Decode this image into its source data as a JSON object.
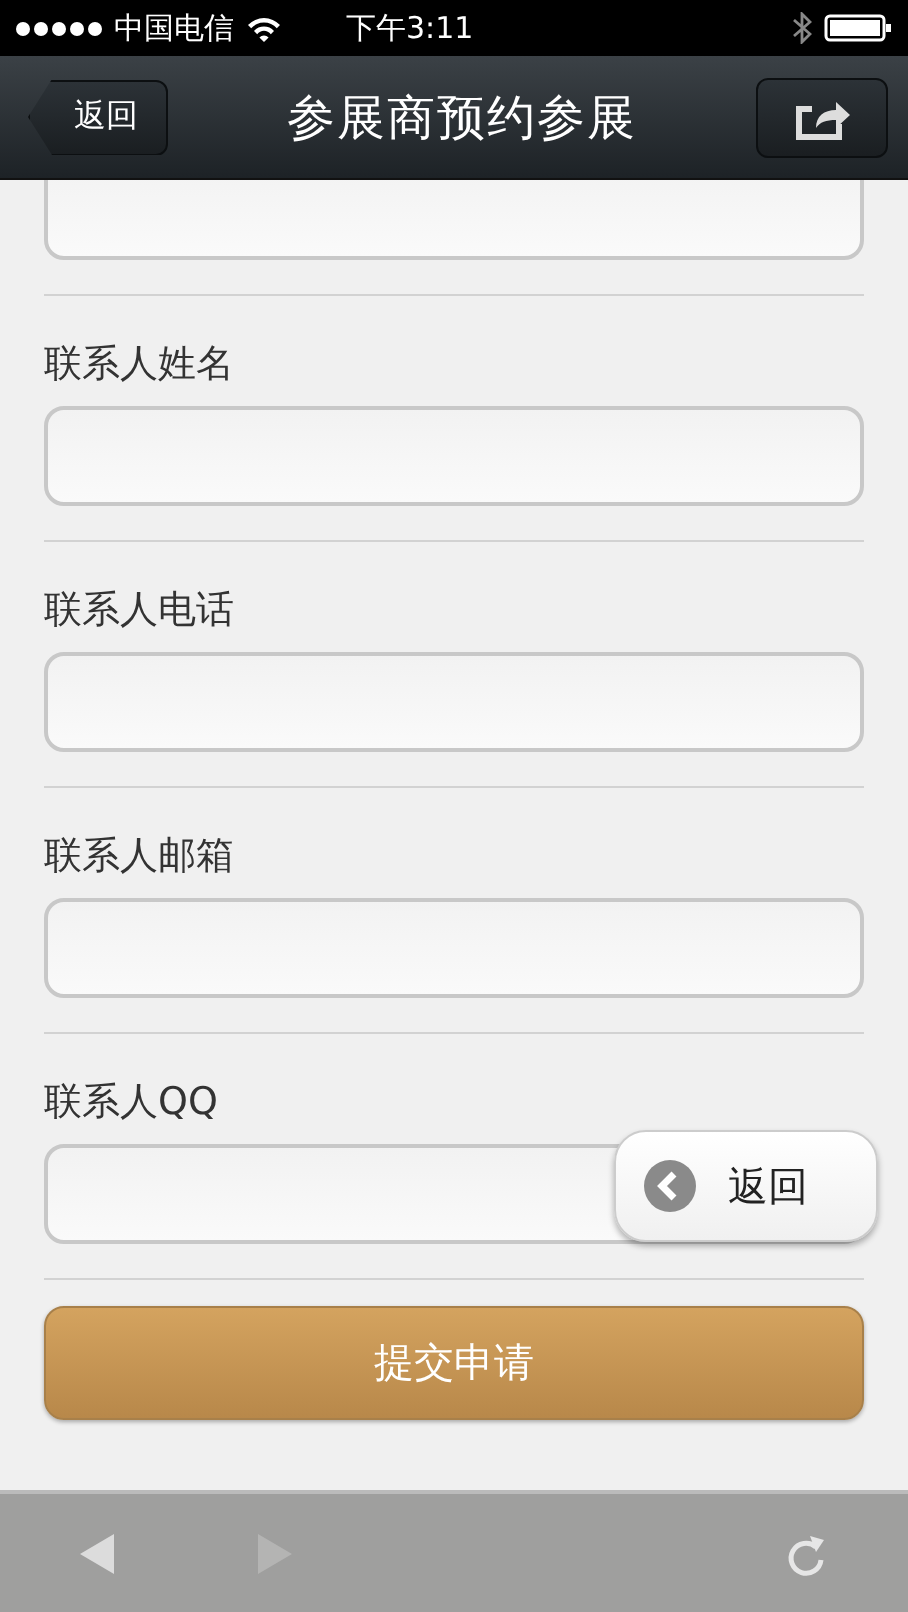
{
  "status_bar": {
    "carrier": "中国电信",
    "time": "下午3:11"
  },
  "nav_bar": {
    "back": "返回",
    "title": "参展商预约参展"
  },
  "form": {
    "fields": [
      {
        "kind": "cut"
      },
      {
        "kind": "labeled",
        "label": "联系人姓名"
      },
      {
        "kind": "labeled",
        "label": "联系人电话"
      },
      {
        "kind": "labeled",
        "label": "联系人邮箱"
      },
      {
        "kind": "labeled",
        "label": "联系人QQ"
      }
    ],
    "submit": "提交申请"
  },
  "floating_back": {
    "label": "返回"
  },
  "toolbar": {
    "back_disabled": false,
    "forward_disabled": true
  }
}
